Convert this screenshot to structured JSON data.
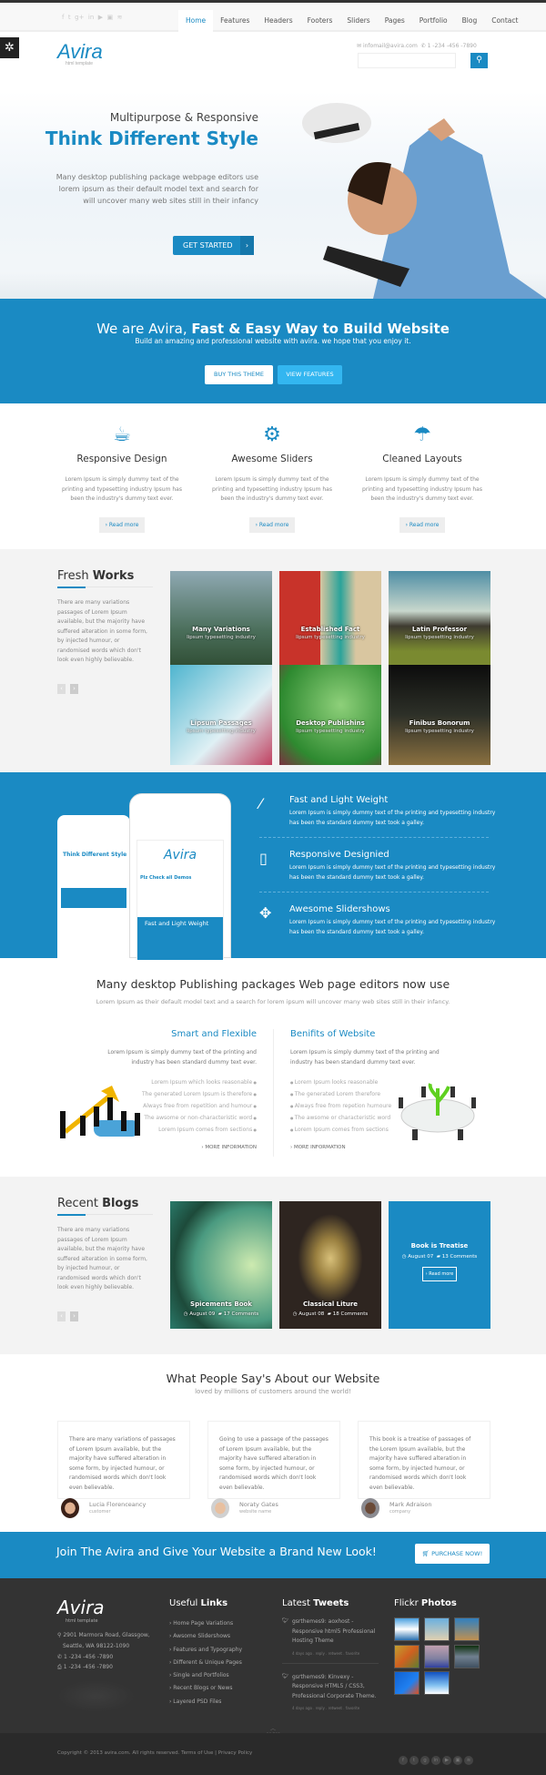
{
  "topbar": {
    "social_icons": [
      "facebook-icon",
      "twitter-icon",
      "google-plus-icon",
      "linkedin-icon",
      "youtube-icon",
      "flickr-icon",
      "rss-icon"
    ],
    "nav": [
      "Home",
      "Features",
      "Headers",
      "Footers",
      "Sliders",
      "Pages",
      "Portfolio",
      "Blog",
      "Contact"
    ],
    "active": "Home"
  },
  "header": {
    "logo": "Avira",
    "logo_sub": "html template",
    "email": "infomail@avira.com",
    "phone": "1 -234 -456 -7890",
    "search_placeholder": ""
  },
  "hero": {
    "subtitle": "Multipurpose & Responsive",
    "title": "Think Different Style",
    "text": "Many desktop publishing package webpage editors use lorem ipsum as their default model text and search for will uncover many web sites still in their infancy",
    "cta": "GET STARTED"
  },
  "band": {
    "title_light": "We are Avira, ",
    "title_bold": "Fast & Easy Way to Build Website",
    "subtitle": "Build an amazing and professional website with avira. we hope that you enjoy it.",
    "buy": "BUY THIS THEME",
    "view": "VIEW FEATURES"
  },
  "services": [
    {
      "icon": "coffee-cup-icon",
      "title": "Responsive Design",
      "text": "Lorem Ipsum is simply dummy text of the printing and typesetting industry Ipsum has been the industry's dummy text ever.",
      "more": "› Read more"
    },
    {
      "icon": "gear-icon",
      "title": "Awesome Sliders",
      "text": "Lorem Ipsum is simply dummy text of the printing and typesetting industry Ipsum has been the industry's dummy text ever.",
      "more": "› Read more"
    },
    {
      "icon": "umbrella-icon",
      "title": "Cleaned Layouts",
      "text": "Lorem Ipsum is simply dummy text of the printing and typesetting industry Ipsum has been the industry's dummy text ever.",
      "more": "› Read more"
    }
  ],
  "works": {
    "title_light": "Fresh ",
    "title_bold": "Works",
    "text": "There are many variations passages of Lorem Ipsum available, but the majority have suffered alteration in some form, by injected humour, or randomised words which don't look even highly believable.",
    "items": [
      {
        "title": "Many Variations",
        "sub": "Iipsum typesetting industry"
      },
      {
        "title": "Established Fact",
        "sub": "Iipsum typesetting industry"
      },
      {
        "title": "Latin Professor",
        "sub": "Iipsum typesetting industry"
      },
      {
        "title": "Lipsum Passages",
        "sub": "Iipsum typesetting industry"
      },
      {
        "title": "Desktop Publishins",
        "sub": "Iipsum typesetting industry"
      },
      {
        "title": "Finibus Bonorum",
        "sub": "Iipsum typesetting industry"
      }
    ]
  },
  "features": {
    "items": [
      {
        "icon": "magic-wand-icon",
        "title": "Fast and Light Weight",
        "text": "Lorem Ipsum is simply dummy text of the printing and typesetting industry has been the standard dummy text took a galley."
      },
      {
        "icon": "tablet-icon",
        "title": "Responsive Designied",
        "text": "Lorem Ipsum is simply dummy text of the printing and typesetting industry has been the standard dummy text took a galley."
      },
      {
        "icon": "move-arrows-icon",
        "title": "Awesome Slidershows",
        "text": "Lorem Ipsum is simply dummy text of the printing and typesetting industry has been the standard dummy text took a galley."
      }
    ],
    "phone_logo": "Avira",
    "phone_title": "Plz Check all Demos",
    "tablet_title": "Think Different Style"
  },
  "publishing": {
    "title": "Many desktop Publishing packages Web page editors now use",
    "subtitle": "Lorem Ipsum as their default model text and a search for lorem ipsum will uncover many web sites still in their infancy.",
    "left": {
      "title": "Smart and Flexible",
      "text": "Lorem Ipsum is simply dummy text of the printing and industry has been standard dummy text ever.",
      "items": [
        "Lorem Ipsum which looks reasonable",
        "The generated Lorem Ipsum is therefore",
        "Always free from repetition and humour",
        "The awsome or non-characteristic word",
        "Lorem Ipsum comes from sections"
      ],
      "more": "› MORE INFORMATION"
    },
    "right": {
      "title": "Benifits of Website",
      "text": "Lorem Ipsum is simply dummy text of the printing and industry has been standard dummy text ever.",
      "items": [
        "Lorem Ipsum looks reasonable",
        "The generated Lorem therefore",
        "Always free from repetion humoure",
        "The awsome or characteristic word",
        "Lorem Ipsum comes from sections"
      ],
      "more": "› MORE INFORMATION"
    }
  },
  "blogs": {
    "title_light": "Recent ",
    "title_bold": "Blogs",
    "text": "There are many variations passages of Lorem Ipsum available, but the majority have suffered alteration in some form, by injected humour, or randomised words which don't look even highly believable.",
    "items": [
      {
        "title": "Spicements Book",
        "date": "August 09",
        "comments": "17 Comments"
      },
      {
        "title": "Classical Liture",
        "date": "August 08",
        "comments": "18 Comments"
      },
      {
        "title": "Book is Treatise",
        "date": "August 07",
        "comments": "13 Comments",
        "more": "› Read more"
      }
    ]
  },
  "testimonials": {
    "title": "What People Say's About our Website",
    "subtitle": "loved by millions of customers around the world!",
    "items": [
      {
        "text": "There are many variations of passages of Lorem Ipsum available, but the majority have suffered alteration in some form, by injected humour, or randomised words which don't look even believable.",
        "name": "Lucia Florenceancy",
        "role": "customer"
      },
      {
        "text": "Going to use a passage of the passages of Lorem Ipsum available, but the majority have suffered alteration in some form, by injected humour, or randomised words which don't look even believable.",
        "name": "Noraty Gates",
        "role": "website name"
      },
      {
        "text": "This book is a treatise of passages of the Lorem Ipsum available, but the majority have suffered alteration in some form, by injected humour, or randomised words which don't look even believable.",
        "name": "Mark Adraison",
        "role": "company"
      }
    ]
  },
  "join": {
    "text": "Join The Avira and Give Your Website a Brand New Look!",
    "button": "PURCHASE NOW!"
  },
  "footer": {
    "logo": "Avira",
    "logo_sub": "html template",
    "address1": "2901 Marmora Road, Glassgow,",
    "address2": "Seattle, WA 98122-1090",
    "phone": "1 -234 -456 -7890",
    "fax": "1 -234 -456 -7890",
    "links_light": "Useful ",
    "links_bold": "Links",
    "links": [
      "› Home Page Variations",
      "› Awsome Slidershows",
      "› Features and Typography",
      "› Different & Unique Pages",
      "› Single and Portfolios",
      "› Recent Blogs or News",
      "› Layered PSD Files"
    ],
    "tweets_light": "Latest ",
    "tweets_bold": "Tweets",
    "tweets": [
      {
        "text": "gsrthemes9: aoxhost - Responsive html5 Professional Hosting Theme",
        "meta": "4 days ago . reply . retweet . favorite"
      },
      {
        "text": "gsrthemes9: Kinvexy - Responsive HTML5 / CSS3, Professional Corporate Theme.",
        "meta": "4 days ago . reply . retweet . favorite"
      }
    ],
    "flickr_light": "Flickr ",
    "flickr_bold": "Photos",
    "go_top": "GO TOP",
    "copyright": "Copyright © 2013 avira.com. All rights reserved. Terms of Use | Privacy Policy"
  },
  "colors": {
    "accent": "#1a8ac3",
    "footer": "#333333"
  }
}
